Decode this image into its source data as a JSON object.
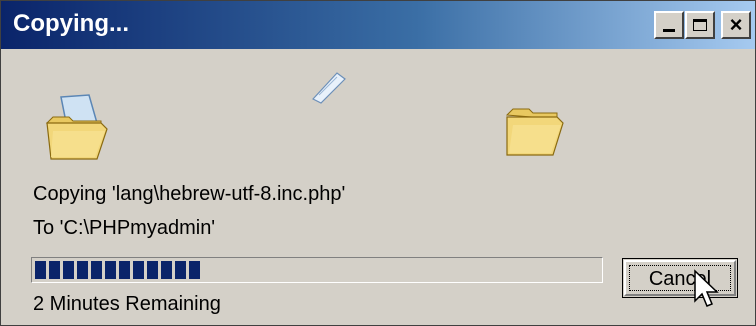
{
  "window": {
    "title": "Copying...",
    "controls": {
      "minimize": "_",
      "close": "×"
    }
  },
  "copy": {
    "source_line": "Copying 'lang\\hebrew-utf-8.inc.php'",
    "dest_line": "To 'C:\\PHPmyadmin'"
  },
  "progress": {
    "fraction": 0.31
  },
  "status": {
    "time_remaining": "2 Minutes Remaining"
  },
  "buttons": {
    "cancel": "Cancel"
  },
  "icons": {
    "source": "open-folder-icon",
    "flying": "flying-document-icon",
    "destination": "folder-icon",
    "cursor": "mouse-cursor-icon"
  },
  "colors": {
    "title_gradient_start": "#0a246a",
    "title_gradient_end": "#a6caf0",
    "progress_block": "#0a246a",
    "face": "#d4d0c8"
  }
}
